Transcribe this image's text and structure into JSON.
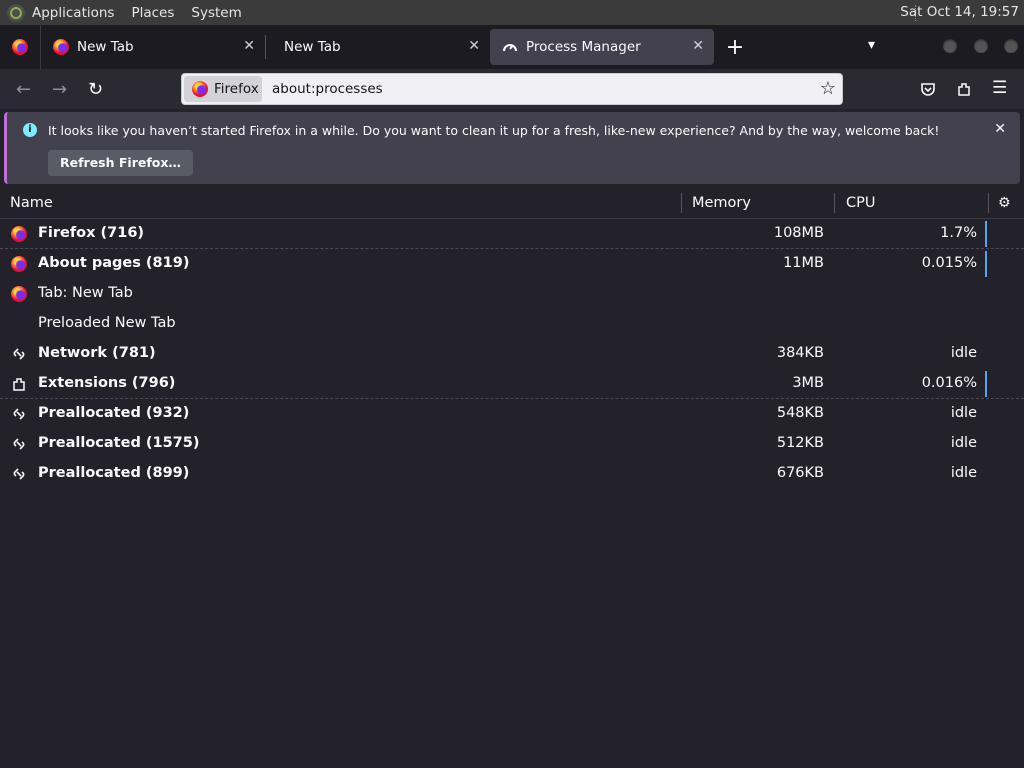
{
  "system_panel": {
    "menus": [
      "Applications",
      "Places",
      "System"
    ],
    "clock": "Sat Oct 14, 19:57"
  },
  "tabs": [
    {
      "title": "New Tab",
      "icon": "firefox-icon"
    },
    {
      "title": "New Tab",
      "icon": "none"
    },
    {
      "title": "Process Manager",
      "icon": "gauge-icon",
      "selected": true
    }
  ],
  "navbar": {
    "identity_label": "Firefox",
    "url": "about:processes"
  },
  "notification": {
    "message": "It looks like you haven’t started Firefox in a while. Do you want to clean it up for a fresh, like-new experience? And by the way, welcome back!",
    "button_label": "Refresh Firefox…"
  },
  "table": {
    "headers": {
      "name": "Name",
      "memory": "Memory",
      "cpu": "CPU"
    },
    "rows": [
      {
        "icon": "firefox-icon",
        "name": "Firefox (716)",
        "bold": true,
        "memory": "108MB",
        "cpu": "1.7%",
        "bar": true
      },
      {
        "icon": "firefox-icon",
        "name": "About pages (819)",
        "bold": true,
        "memory": "11MB",
        "cpu": "0.015%",
        "bar": true
      },
      {
        "icon": "firefox-icon",
        "name": "Tab: New Tab",
        "bold": false,
        "memory": "",
        "cpu": "",
        "bar": false
      },
      {
        "icon": "none",
        "name": "Preloaded New Tab",
        "bold": false,
        "memory": "",
        "cpu": "",
        "bar": false
      },
      {
        "icon": "link-icon",
        "name": "Network (781)",
        "bold": true,
        "memory": "384KB",
        "cpu": "idle",
        "bar": false
      },
      {
        "icon": "puzzle-icon",
        "name": "Extensions (796)",
        "bold": true,
        "memory": "3MB",
        "cpu": "0.016%",
        "bar": true
      },
      {
        "icon": "link-icon",
        "name": "Preallocated (932)",
        "bold": true,
        "memory": "548KB",
        "cpu": "idle",
        "bar": false
      },
      {
        "icon": "link-icon",
        "name": "Preallocated (1575)",
        "bold": true,
        "memory": "512KB",
        "cpu": "idle",
        "bar": false
      },
      {
        "icon": "link-icon",
        "name": "Preallocated (899)",
        "bold": true,
        "memory": "676KB",
        "cpu": "idle",
        "bar": false
      }
    ]
  }
}
